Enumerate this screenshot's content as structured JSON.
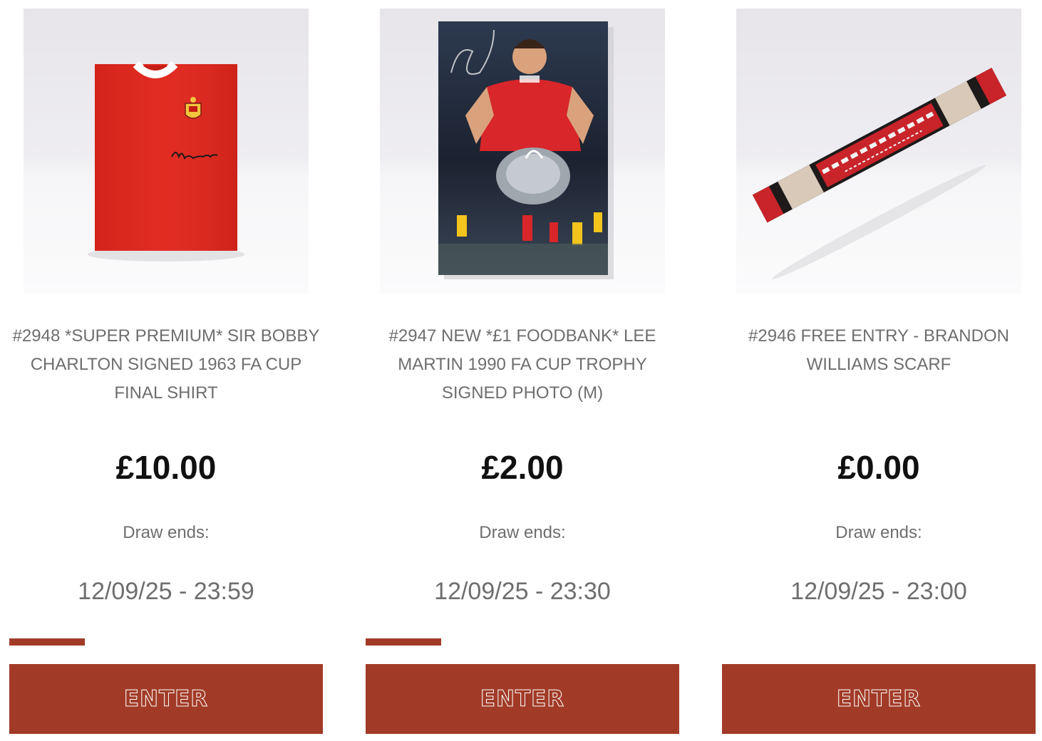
{
  "colors": {
    "accent": "#a13b27",
    "text_muted": "#6e6e6e",
    "price_text": "#111111"
  },
  "cards": [
    {
      "image_icon": "signed-red-shirt-image",
      "title": "#2948 *SUPER PREMIUM* SIR BOBBY CHARLTON SIGNED 1963 FA CUP FINAL SHIRT",
      "price": "£10.00",
      "draw_ends_label": "Draw ends:",
      "draw_ends_value": "12/09/25 - 23:59",
      "progress_fraction": 0.24,
      "button_label": "ENTER"
    },
    {
      "image_icon": "signed-photo-image",
      "title": "#2947 NEW *£1 FOODBANK* LEE MARTIN 1990 FA CUP TROPHY SIGNED PHOTO (M)",
      "price": "£2.00",
      "draw_ends_label": "Draw ends:",
      "draw_ends_value": "12/09/25 - 23:30",
      "progress_fraction": 0.24,
      "button_label": "ENTER"
    },
    {
      "image_icon": "scarf-image",
      "title": "#2946 FREE ENTRY - BRANDON WILLIAMS SCARF",
      "price": "£0.00",
      "draw_ends_label": "Draw ends:",
      "draw_ends_value": "12/09/25 - 23:00",
      "progress_fraction": 0,
      "button_label": "ENTER"
    }
  ]
}
